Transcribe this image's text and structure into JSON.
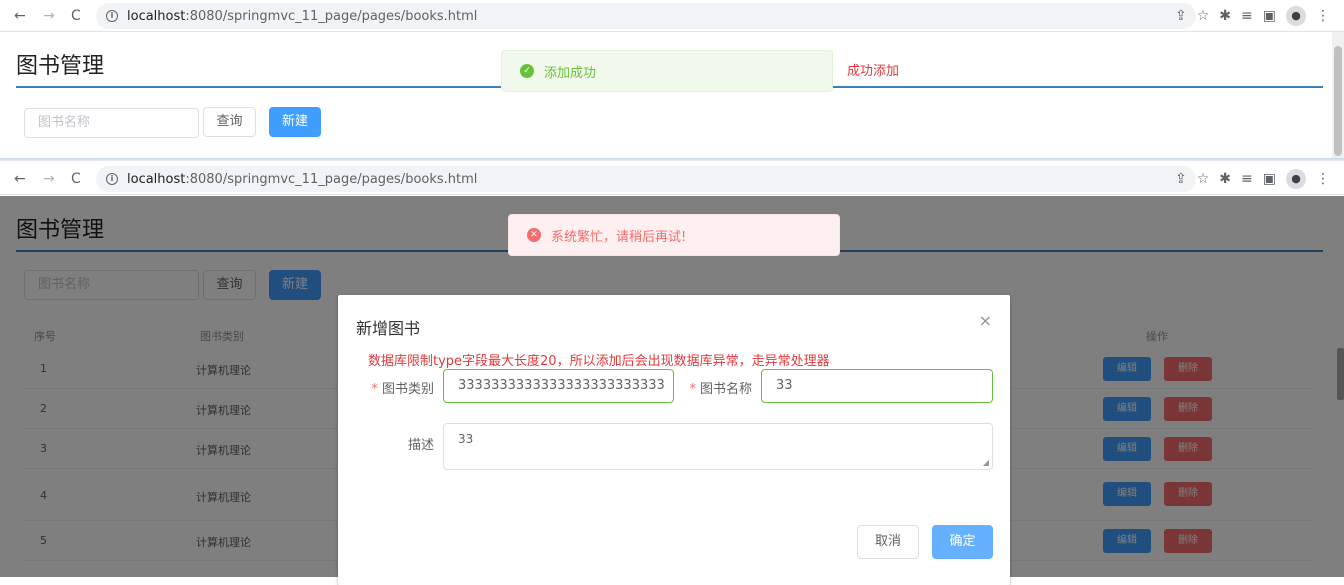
{
  "browser": {
    "back_icon": "←",
    "forward_icon": "→",
    "reload_icon": "C",
    "info_icon": "i",
    "url_host": "localhost",
    "url_rest": ":8080/springmvc_11_page/pages/books.html",
    "share_icon": "⇪",
    "star_icon": "☆",
    "extensions_icon": "✱",
    "queue_icon": "≡",
    "sidepanel_icon": "▣",
    "profile_icon": "●",
    "menu_icon": "⋮"
  },
  "page": {
    "title": "图书管理",
    "search_placeholder": "图书名称",
    "query_label": "查询",
    "new_label": "新建"
  },
  "top_message": {
    "text": "添加成功",
    "icon": "✓",
    "annotation": "成功添加"
  },
  "error_message": {
    "text": "系统繁忙，请稍后再试!",
    "icon": "✕"
  },
  "table": {
    "columns": [
      "序号",
      "图书类别",
      "操作"
    ],
    "rows": [
      {
        "index": "1",
        "type": "计算机理论"
      },
      {
        "index": "2",
        "type": "计算机理论"
      },
      {
        "index": "3",
        "type": "计算机理论"
      },
      {
        "index": "4",
        "type": "计算机理论"
      },
      {
        "index": "5",
        "type": "计算机理论"
      }
    ],
    "edit_label": "编辑",
    "delete_label": "删除"
  },
  "dialog": {
    "title": "新增图书",
    "close_icon": "×",
    "note": "数据库限制type字段最大长度20，所以添加后会出现数据库异常，走异常处理器",
    "type_label": "图书类别",
    "type_value": "3333333333333333333333333",
    "name_label": "图书名称",
    "name_value": "33",
    "desc_label": "描述",
    "desc_value": "33",
    "required_mark": "*",
    "resize_icon": "◢",
    "cancel_label": "取消",
    "ok_label": "确定"
  }
}
